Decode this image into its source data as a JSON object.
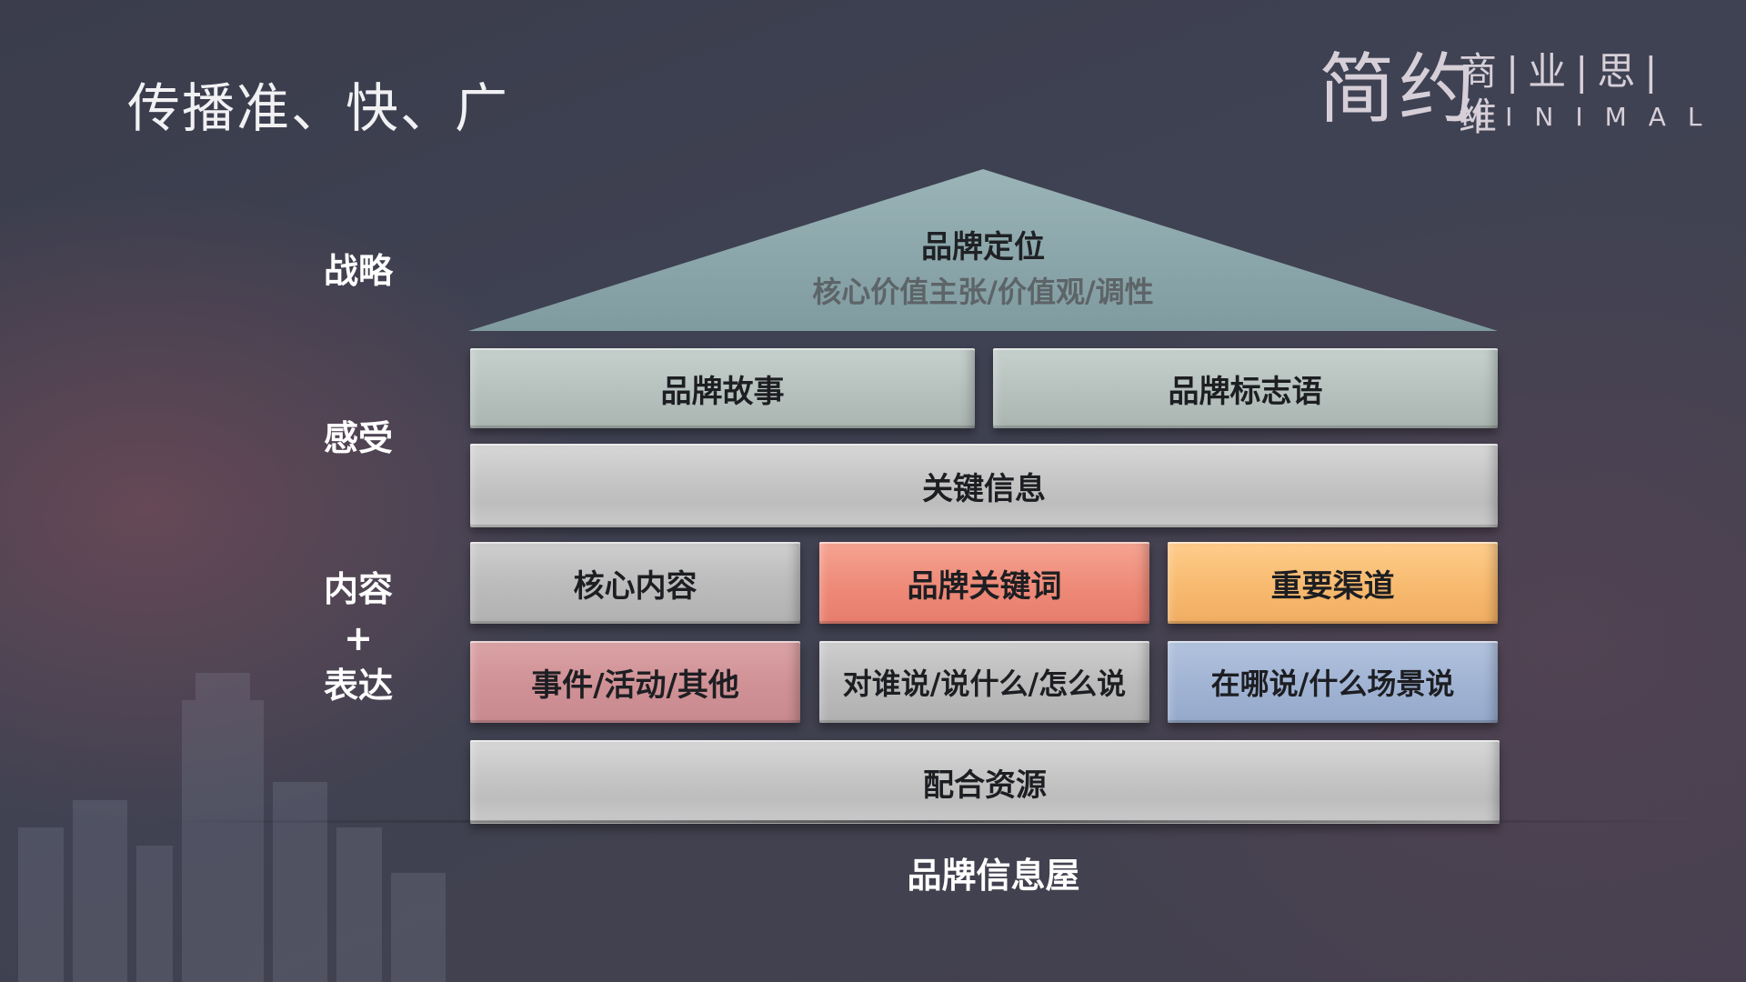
{
  "slide": {
    "title": "传播准、快、广"
  },
  "logo": {
    "text_cn_main": "简约",
    "text_cn_sub": "商|业|思|维",
    "text_en": "MINIMAL"
  },
  "side_labels": {
    "strategy": "战略",
    "feeling": "感受",
    "content_line1": "内容",
    "plus": "+",
    "content_line2": "表达"
  },
  "roof": {
    "title": "品牌定位",
    "subtitle": "核心价值主张/价值观/调性",
    "color": "#86a1a6"
  },
  "rows": {
    "story": "品牌故事",
    "slogan": "品牌标志语",
    "key_message": "关键信息",
    "core_content": "核心内容",
    "brand_keywords": "品牌关键词",
    "key_channels": "重要渠道",
    "events": "事件/活动/其他",
    "audience": "对谁说/说什么/怎么说",
    "scenes": "在哪说/什么场景说",
    "resources": "配合资源"
  },
  "caption": "品牌信息屋",
  "colors": {
    "sage": "#b6c1bd",
    "metal": "#c4c4c4",
    "salmon": "#ee8a78",
    "orange": "#f7ba6f",
    "pink": "#cf9195",
    "blue": "#a0b3d3"
  }
}
